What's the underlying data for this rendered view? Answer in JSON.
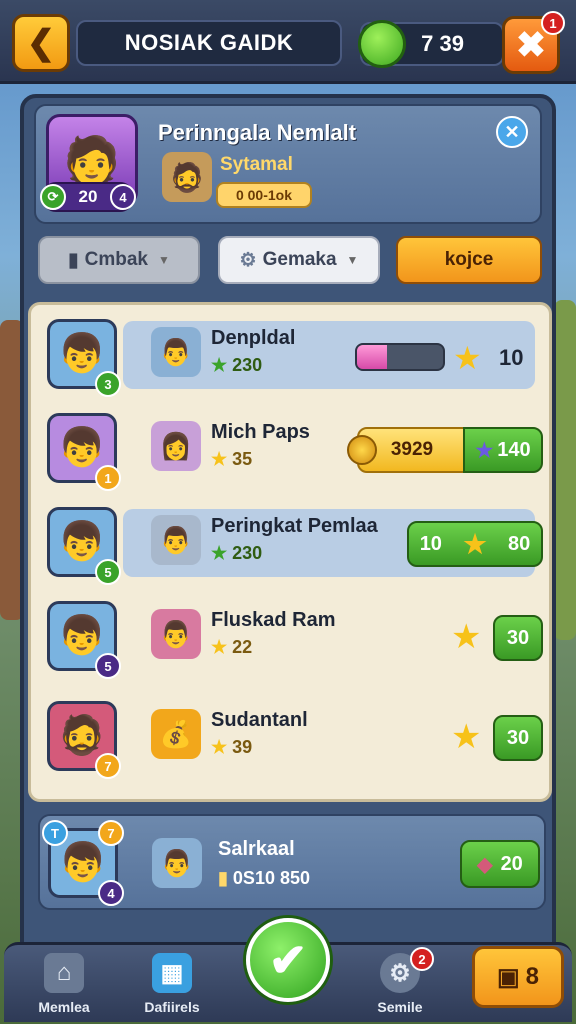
{
  "header": {
    "title": "NOSIAK GAIDK",
    "gem_value": "7 39",
    "close_badge": "1",
    "back_icon": "chevron-left-icon",
    "close_icon": "close-icon"
  },
  "profile": {
    "title": "Perinngala Nemlalt",
    "level": "20",
    "rank_badge": "4",
    "sub_name": "Sytamal",
    "sub_value": "0 00-1ok"
  },
  "filters": [
    {
      "label": "Cmbak"
    },
    {
      "label": "Gemaka"
    },
    {
      "label": "kojce"
    }
  ],
  "rows": [
    {
      "name": "Denpldal",
      "points": "230",
      "badge": "3",
      "value": "10",
      "progress": 0.35,
      "color": "#7ab3e0"
    },
    {
      "name": "Mich Paps",
      "points": "35",
      "badge": "1",
      "coin_value": "3929",
      "value": "140",
      "color": "#b78be0"
    },
    {
      "name": "Peringkat Pemlaa",
      "points": "230",
      "badge": "5",
      "left_value": "10",
      "value": "80",
      "color": "#7ab3e0"
    },
    {
      "name": "Fluskad Ram",
      "points": "22",
      "badge": "5",
      "value": "30",
      "color": "#7ab3e0"
    },
    {
      "name": "Sudantanl",
      "points": "39",
      "badge": "7",
      "value": "30",
      "color": "#d45a7a"
    }
  ],
  "player": {
    "name": "Salrkaal",
    "points": "0S10 850",
    "badge_top": "7",
    "badge_bottom": "4",
    "value": "20"
  },
  "nav": [
    {
      "label": "Memlea",
      "icon": "home-icon"
    },
    {
      "label": "Dafiirels",
      "icon": "calendar-icon"
    },
    {
      "label": "Semile",
      "icon": "gear-icon",
      "badge": "2"
    }
  ],
  "nav_right": "8"
}
